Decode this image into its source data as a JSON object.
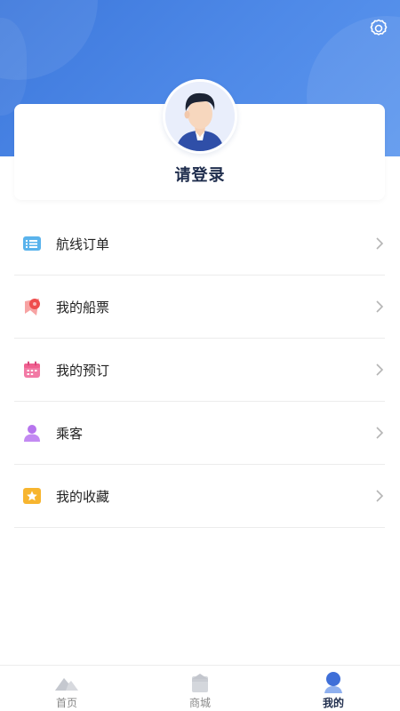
{
  "header": {
    "settings_icon": "gear-icon"
  },
  "profile": {
    "login_label": "请登录",
    "avatar_icon": "user-avatar"
  },
  "menu": {
    "items": [
      {
        "label": "航线订单",
        "icon": "list-icon",
        "color": "#4aa8e8"
      },
      {
        "label": "我的船票",
        "icon": "ticket-icon",
        "color": "#f05a5a"
      },
      {
        "label": "我的预订",
        "icon": "calendar-icon",
        "color": "#f07aa0"
      },
      {
        "label": "乘客",
        "icon": "person-icon",
        "color": "#b26be8"
      },
      {
        "label": "我的收藏",
        "icon": "star-icon",
        "color": "#f5b52e"
      }
    ]
  },
  "tabbar": {
    "tabs": [
      {
        "label": "首页",
        "icon": "home-icon",
        "active": false
      },
      {
        "label": "商城",
        "icon": "shop-icon",
        "active": false
      },
      {
        "label": "我的",
        "icon": "profile-icon",
        "active": true
      }
    ]
  },
  "colors": {
    "header_blue": "#4a85e4",
    "active_tab": "#1f2d4d"
  }
}
